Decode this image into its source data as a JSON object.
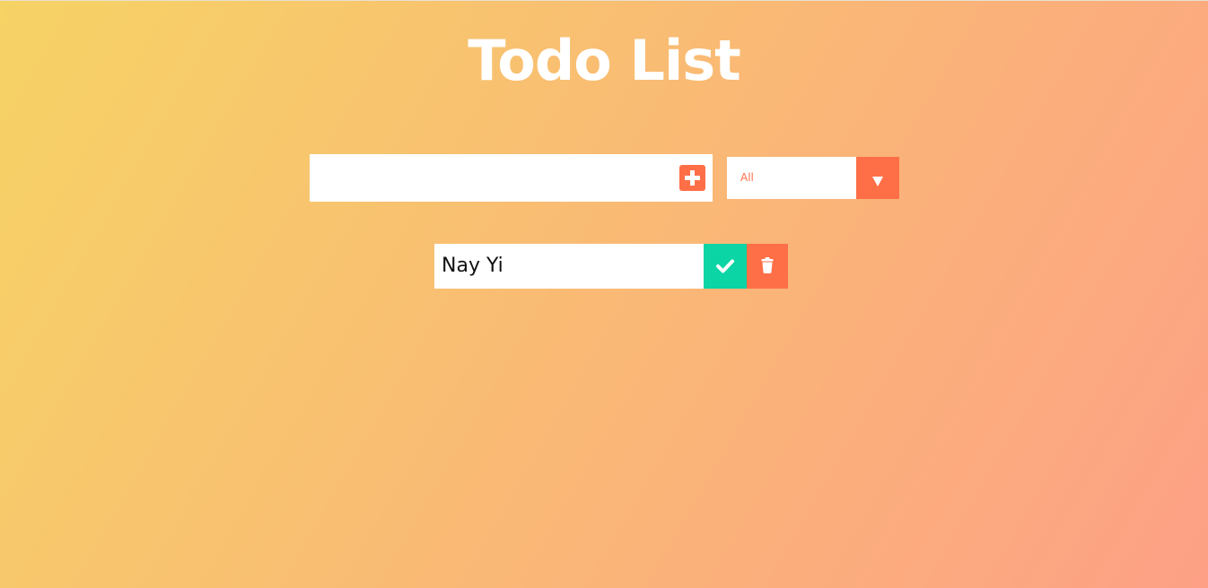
{
  "header": {
    "title": "Todo List"
  },
  "form": {
    "input_value": "",
    "input_placeholder": "",
    "add_icon": "plus-square-icon"
  },
  "filter": {
    "selected": "All",
    "arrow_icon": "caret-down-icon"
  },
  "todos": [
    {
      "text": "Nay Yi",
      "complete_icon": "check-icon",
      "delete_icon": "trash-icon"
    }
  ],
  "colors": {
    "gradient_start": "#f6d365",
    "gradient_end": "#fda085",
    "accent": "#ff6f47",
    "complete": "#0bd4a5",
    "text": "#111111"
  }
}
